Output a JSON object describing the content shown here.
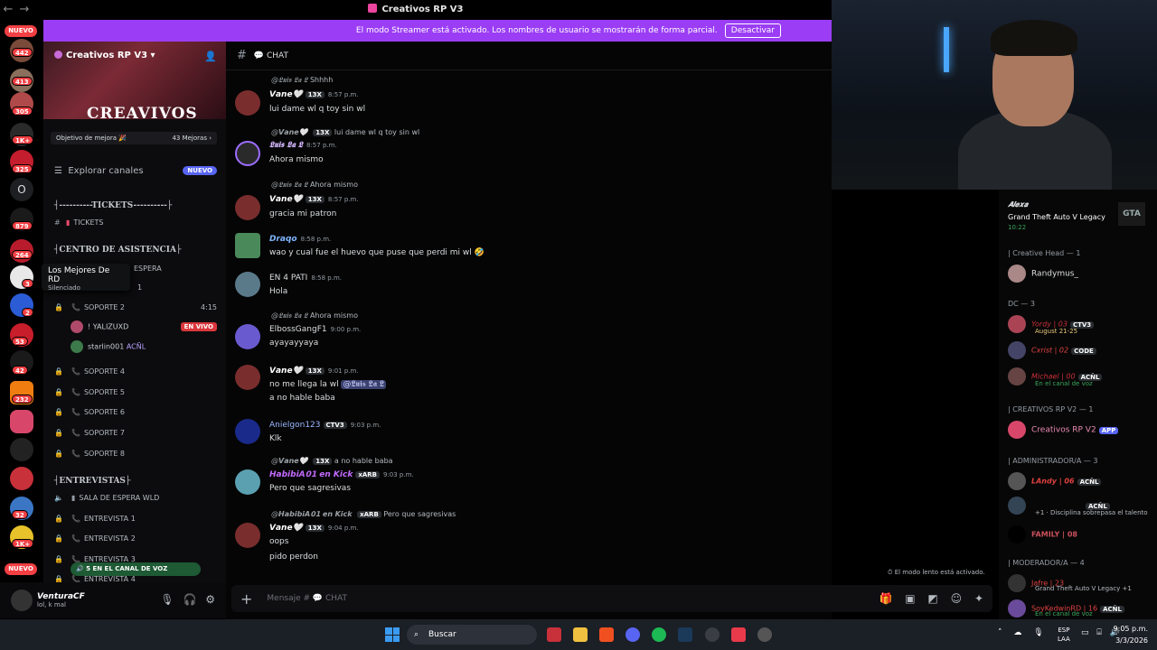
{
  "window": {
    "title": "Creativos RP V3",
    "back": "←",
    "forward": "→"
  },
  "banner": {
    "text": "El modo Streamer está activado. Los nombres de usuario se mostrarán de forma parcial.",
    "button": "Desactivar"
  },
  "rail": {
    "top_pill": "NUEVO",
    "bottom_pill": "NUEVO",
    "badges": [
      "442",
      "413",
      "305",
      "1K+",
      "325",
      "879",
      "264",
      "3",
      "2",
      "53",
      "42",
      "232",
      "32",
      "1K+"
    ],
    "letter_server": "O"
  },
  "server": {
    "name": "Creativos RP V3",
    "banner_logo": "CREAVIVOS",
    "boost_label": "Objetivo de mejora 🎉",
    "boost_count": "43 Mejoras ›",
    "explore": "Explorar canales",
    "explore_badge": "NUEVO"
  },
  "channels": {
    "cat_tickets": "┤----------TICKETS----------├",
    "ch_tickets": "TICKETS",
    "cat_asistencia": "┤CENTRO DE ASISTENCIA├",
    "espera_fragment": "ESPERA",
    "soporte1_fragment": "1",
    "soporte2": "SOPORTE 2",
    "soporte2_time": "4:15",
    "voice_user1": "! YALIZUXD",
    "voice_user1_status": "EN VIVO",
    "voice_user2": "starlin001",
    "voice_user2_tag": "ACÑL",
    "soporte4": "SOPORTE 4",
    "soporte5": "SOPORTE 5",
    "soporte6": "SOPORTE 6",
    "soporte7": "SOPORTE 7",
    "soporte8": "SOPORTE 8",
    "cat_entrevistas": "┤ENTREVISTAS├",
    "sala_espera": "SALA DE ESPERA WLD",
    "entrevista1": "ENTREVISTA 1",
    "entrevista2": "ENTREVISTA 2",
    "entrevista3": "ENTREVISTA 3",
    "entrevista4": "ENTREVISTA 4",
    "voice_count": "5 EN EL CANAL DE VOZ"
  },
  "tooltip": {
    "title": "Los Mejores De RD",
    "subtitle": "Silenciado"
  },
  "user": {
    "name": "VenturaCF",
    "status": "lol, k mal"
  },
  "chat": {
    "channel": "CHAT",
    "messages": [
      {
        "reply_user": "@𝕷𝖚𝖎𝖘 𝕷𝖆 𝕷",
        "reply_text": "Shhhh",
        "user": "𝙑𝙖𝙣𝙚🤍",
        "tag": "13X",
        "time": "8:57 p.m.",
        "text": "lui dame wl q toy sin wl"
      },
      {
        "reply_user": "@𝙑𝙖𝙣𝙚🤍",
        "reply_tag": "13X",
        "reply_text": "lui dame wl q toy sin wl",
        "user": "𝕷𝖚𝖎𝖘 𝕷𝖆 𝕷",
        "time": "8:57 p.m.",
        "text": "Ahora mismo"
      },
      {
        "reply_user": "@𝕷𝖚𝖎𝖘 𝕷𝖆 𝕷",
        "reply_text": "Ahora mismo",
        "user": "𝙑𝙖𝙣𝙚🤍",
        "tag": "13X",
        "time": "8:57 p.m.",
        "text": "gracia mi patron"
      },
      {
        "user": "Draqo",
        "time": "8:58 p.m.",
        "text": "wao y cual fue el huevo que puse que perdi mi wl 🤣"
      },
      {
        "user": "EN 4 PATI",
        "time": "8:58 p.m.",
        "text": "Hola"
      },
      {
        "reply_user": "@𝕷𝖚𝖎𝖘 𝕷𝖆 𝕷",
        "reply_text": "Ahora mismo",
        "user": "ElbossGangF1",
        "time": "9:00 p.m.",
        "text": "ayayayyaya"
      },
      {
        "user": "𝙑𝙖𝙣𝙚🤍",
        "tag": "13X",
        "time": "9:01 p.m.",
        "text": "no me llega la wl",
        "mention": "@𝕷𝖚𝖎𝖘 𝕷𝖆 𝕷",
        "text2": "a no hable baba"
      },
      {
        "user": "Anielgon123",
        "tag": "CTV3",
        "time": "9:03 p.m.",
        "text": "Klk"
      },
      {
        "reply_user": "@𝙑𝙖𝙣𝙚🤍",
        "reply_tag": "13X",
        "reply_text": "a no hable baba",
        "user": "𝙃𝙖𝙗𝙞𝙗𝙞𝘼𝟬𝟭 𝙚𝙣 𝙆𝙞𝙘𝙠",
        "tag": "xARB",
        "time": "9:03 p.m.",
        "text": "Pero que sagresivas"
      },
      {
        "reply_user": "@𝙃𝙖𝙗𝙞𝙗𝙞𝘼𝟬𝟭 𝙚𝙣 𝙆𝙞𝙘𝙠",
        "reply_tag": "xARB",
        "reply_text": "Pero que sagresivas",
        "user": "𝙑𝙖𝙣𝙚🤍",
        "tag": "13X",
        "time": "9:04 p.m.",
        "text": "oops",
        "text2": "pido perdon"
      }
    ],
    "slowmode": "El modo lento está activado.",
    "placeholder": "Mensaje #",
    "placeholder_channel": "CHAT"
  },
  "members": {
    "activity_user": "𝑨𝒍𝒆𝒙𝒂",
    "activity_game": "Grand Theft Auto V Legacy",
    "activity_time": "10:22",
    "groups": [
      {
        "title": "| Creative Head — 1",
        "members": [
          {
            "name": "Randymus_"
          }
        ]
      },
      {
        "title": "DC — 3",
        "members": [
          {
            "name": "Yordy | 03",
            "tag": "CTV3",
            "sub": "August 21-25"
          },
          {
            "name": "Cxrist | 02",
            "tag": "CODE"
          },
          {
            "name": "Michael | 00",
            "tag": "ACÑL",
            "sub": "En el canal de voz"
          }
        ]
      },
      {
        "title": "| CREATIVOS RP V2 — 1",
        "members": [
          {
            "name": "Creativos RP V2",
            "tag": "APP"
          }
        ]
      },
      {
        "title": "| ADMINISTRADOR/A — 3",
        "members": [
          {
            "name": "LAndy | 06",
            "tag": "ACÑL"
          },
          {
            "name": "",
            "tag": "ACÑL",
            "sub": "+1 · Disciplina sobrepasa el talento"
          },
          {
            "name": "FAMILY | 08"
          }
        ]
      },
      {
        "title": "| MODERADOR/A — 4",
        "members": [
          {
            "name": "Jafre | 23",
            "sub": "Grand Theft Auto V Legacy +1"
          },
          {
            "name": "SoyKedwinRD | 16",
            "tag": "ACÑL",
            "sub": "En el canal de voz"
          }
        ]
      }
    ]
  },
  "taskbar": {
    "search": "Buscar",
    "lang1": "ESP",
    "lang2": "LAA",
    "time": "9:05 p.m.",
    "date": "3/3/2026",
    "tray_arrow": "˄"
  },
  "colors": {
    "accent": "#9b3df5",
    "danger": "#f23f43",
    "brand": "#5865f2"
  }
}
